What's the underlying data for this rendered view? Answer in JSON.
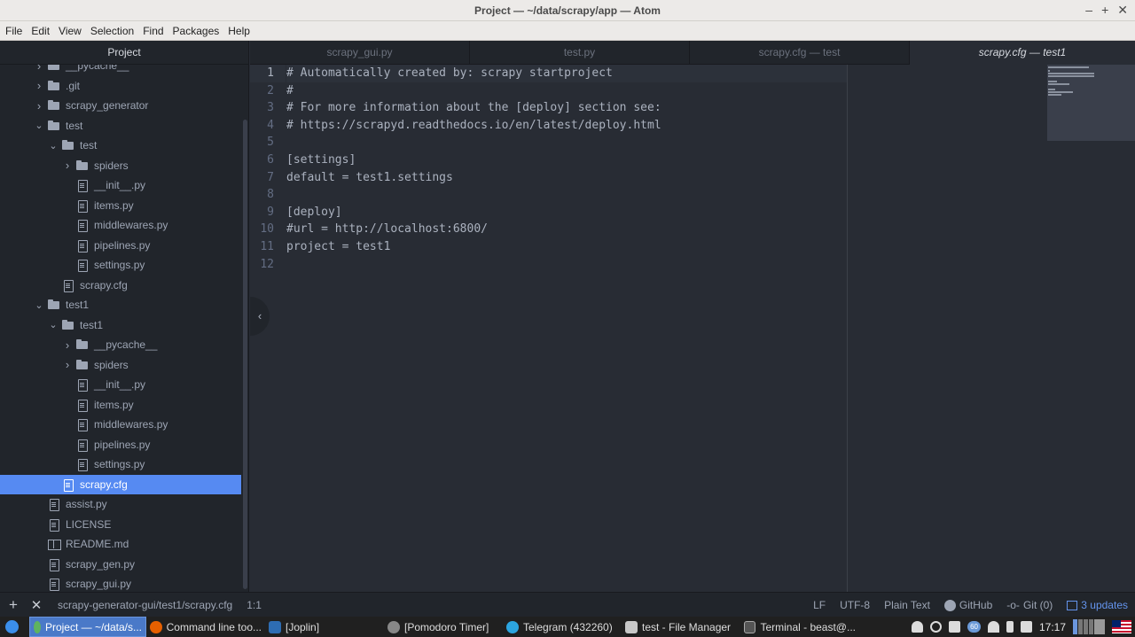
{
  "window": {
    "title": "Project — ~/data/scrapy/app — Atom",
    "controls": [
      "–",
      "+",
      "✕"
    ]
  },
  "menu": [
    "File",
    "Edit",
    "View",
    "Selection",
    "Find",
    "Packages",
    "Help"
  ],
  "sidebar": {
    "title": "Project",
    "tree": [
      {
        "label": "__pycache__",
        "type": "folder",
        "depth": 1,
        "expanded": false
      },
      {
        "label": ".git",
        "type": "folder",
        "depth": 1,
        "expanded": false
      },
      {
        "label": "scrapy_generator",
        "type": "folder",
        "depth": 1,
        "expanded": false
      },
      {
        "label": "test",
        "type": "folder",
        "depth": 1,
        "expanded": true
      },
      {
        "label": "test",
        "type": "folder",
        "depth": 2,
        "expanded": true
      },
      {
        "label": "spiders",
        "type": "folder",
        "depth": 3,
        "expanded": false
      },
      {
        "label": "__init__.py",
        "type": "file",
        "depth": 3
      },
      {
        "label": "items.py",
        "type": "file",
        "depth": 3
      },
      {
        "label": "middlewares.py",
        "type": "file",
        "depth": 3
      },
      {
        "label": "pipelines.py",
        "type": "file",
        "depth": 3
      },
      {
        "label": "settings.py",
        "type": "file",
        "depth": 3
      },
      {
        "label": "scrapy.cfg",
        "type": "file",
        "depth": 2
      },
      {
        "label": "test1",
        "type": "folder",
        "depth": 1,
        "expanded": true
      },
      {
        "label": "test1",
        "type": "folder",
        "depth": 2,
        "expanded": true
      },
      {
        "label": "__pycache__",
        "type": "folder",
        "depth": 3,
        "expanded": false
      },
      {
        "label": "spiders",
        "type": "folder",
        "depth": 3,
        "expanded": false
      },
      {
        "label": "__init__.py",
        "type": "file",
        "depth": 3
      },
      {
        "label": "items.py",
        "type": "file",
        "depth": 3
      },
      {
        "label": "middlewares.py",
        "type": "file",
        "depth": 3
      },
      {
        "label": "pipelines.py",
        "type": "file",
        "depth": 3
      },
      {
        "label": "settings.py",
        "type": "file",
        "depth": 3
      },
      {
        "label": "scrapy.cfg",
        "type": "file",
        "depth": 2,
        "selected": true
      },
      {
        "label": "assist.py",
        "type": "file",
        "depth": 1
      },
      {
        "label": "LICENSE",
        "type": "file",
        "depth": 1
      },
      {
        "label": "README.md",
        "type": "book",
        "depth": 1
      },
      {
        "label": "scrapy_gen.py",
        "type": "file",
        "depth": 1
      },
      {
        "label": "scrapy_gui.py",
        "type": "file",
        "depth": 1
      }
    ]
  },
  "tabs": [
    {
      "label": "scrapy_gui.py",
      "active": false
    },
    {
      "label": "test.py",
      "active": false
    },
    {
      "label": "scrapy.cfg — test",
      "active": false
    },
    {
      "label": "scrapy.cfg — test1",
      "active": true
    }
  ],
  "editor": {
    "lines": [
      "# Automatically created by: scrapy startproject",
      "#",
      "# For more information about the [deploy] section see:",
      "# https://scrapyd.readthedocs.io/en/latest/deploy.html",
      "",
      "[settings]",
      "default = test1.settings",
      "",
      "[deploy]",
      "#url = http://localhost:6800/",
      "project = test1",
      ""
    ],
    "current_line": 1
  },
  "status": {
    "file_path": "scrapy-generator-gui/test1/scrapy.cfg",
    "cursor": "1:1",
    "line_ending": "LF",
    "encoding": "UTF-8",
    "grammar": "Plain Text",
    "github": "GitHub",
    "git": "Git (0)",
    "updates": "3 updates"
  },
  "taskbar": {
    "items": [
      {
        "label": "Project — ~/data/s...",
        "active": true,
        "icon_color": "#5fb35f"
      },
      {
        "label": "Command line too...",
        "active": false,
        "icon_color": "#e66000"
      },
      {
        "label": "[Joplin]",
        "active": false,
        "icon_color": "#2e6db3"
      },
      {
        "label": "[Pomodoro Timer]",
        "active": false,
        "icon_color": "#888888"
      },
      {
        "label": "Telegram (432260)",
        "active": false,
        "icon_color": "#2ca5e0"
      },
      {
        "label": "test - File Manager",
        "active": false,
        "icon_color": "#c8c8c8"
      },
      {
        "label": "Terminal - beast@...",
        "active": false,
        "icon_color": "#555555"
      }
    ],
    "clock": "17:17",
    "tray_badge": "60"
  }
}
